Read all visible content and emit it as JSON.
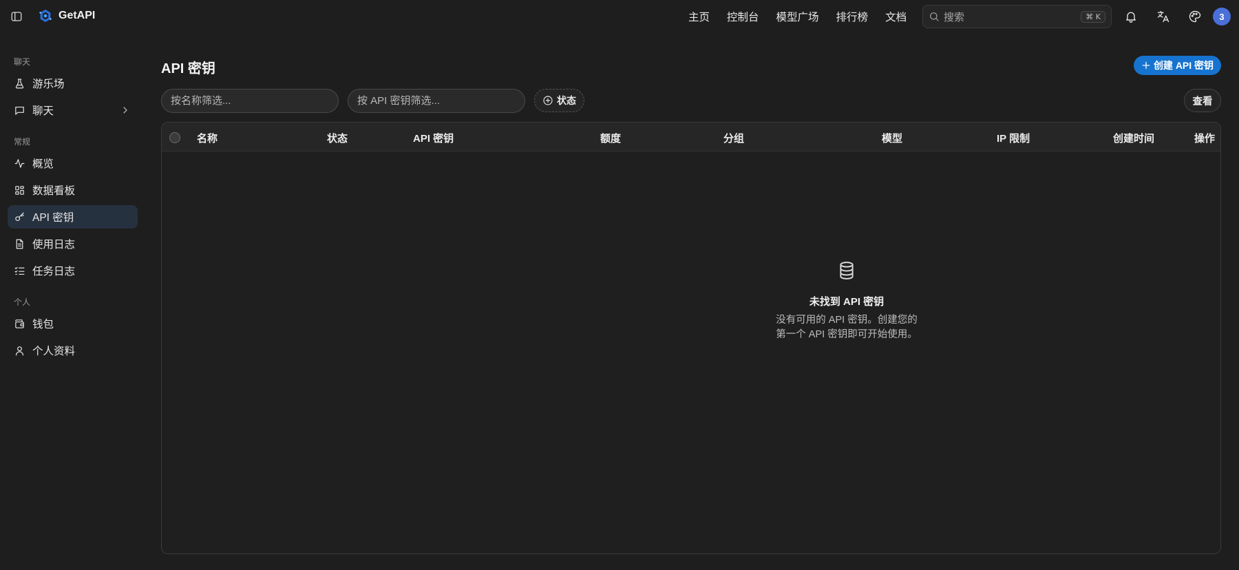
{
  "app": {
    "name": "GetAPI"
  },
  "topnav": [
    "主页",
    "控制台",
    "模型广场",
    "排行榜",
    "文档"
  ],
  "search": {
    "placeholder": "搜索",
    "shortcut": "⌘ K"
  },
  "user": {
    "avatar_text": "3"
  },
  "sidebar": {
    "sections": [
      {
        "label": "聊天",
        "items": [
          {
            "label": "游乐场",
            "icon": "flask-icon"
          },
          {
            "label": "聊天",
            "icon": "message-square-icon",
            "has_chevron": true
          }
        ]
      },
      {
        "label": "常规",
        "items": [
          {
            "label": "概览",
            "icon": "activity-icon"
          },
          {
            "label": "数据看板",
            "icon": "dashboard-icon"
          },
          {
            "label": "API 密钥",
            "icon": "key-icon",
            "active": true
          },
          {
            "label": "使用日志",
            "icon": "file-text-icon"
          },
          {
            "label": "任务日志",
            "icon": "list-checks-icon"
          }
        ]
      },
      {
        "label": "个人",
        "items": [
          {
            "label": "钱包",
            "icon": "wallet-icon"
          },
          {
            "label": "个人资料",
            "icon": "user-icon"
          }
        ]
      }
    ]
  },
  "page": {
    "title": "API 密钥",
    "create_button": "创建 API 密钥",
    "filters": {
      "name_placeholder": "按名称筛选...",
      "key_placeholder": "按 API 密钥筛选...",
      "status_button": "状态"
    },
    "view_button": "查看"
  },
  "table": {
    "columns": [
      "名称",
      "状态",
      "API 密钥",
      "额度",
      "分组",
      "模型",
      "IP 限制",
      "创建时间",
      "操作"
    ],
    "rows": []
  },
  "empty_state": {
    "title": "未找到 API 密钥",
    "description_line1": "没有可用的 API 密钥。创建您的",
    "description_line2": "第一个 API 密钥即可开始使用。"
  },
  "colors": {
    "background": "#1e1e1e",
    "accent": "#1673cf",
    "active_nav": "#26313f",
    "avatar": "#4a6fd8"
  }
}
